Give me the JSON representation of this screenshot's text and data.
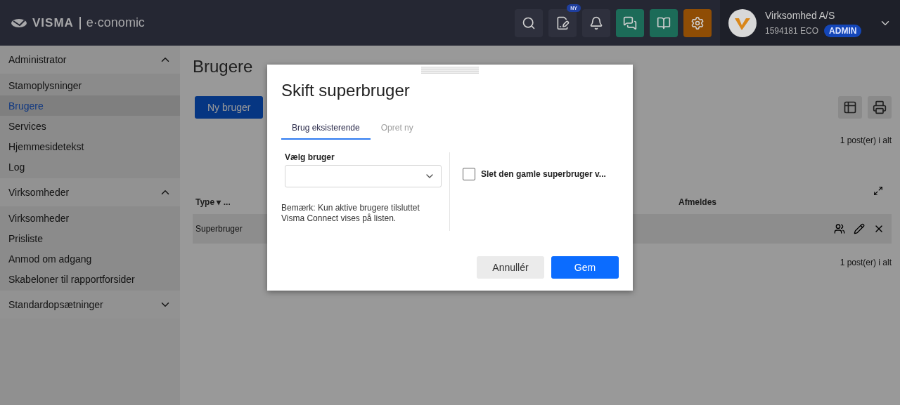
{
  "header": {
    "logo": {
      "brand": "VISMA",
      "product": "e·conomic"
    },
    "tools": [
      {
        "kind": "search",
        "color": "#2e303d"
      },
      {
        "kind": "document",
        "color": "#2e303d",
        "badge": "NY"
      },
      {
        "kind": "bell",
        "color": "#2e303d"
      },
      {
        "kind": "chat",
        "color": "#1c6b58"
      },
      {
        "kind": "book",
        "color": "#1c6b58"
      },
      {
        "kind": "gear",
        "color": "#8f4d05"
      }
    ],
    "account": {
      "company": "Virksomhed A/S",
      "number": "1594181 ECO",
      "role": "ADMIN"
    }
  },
  "sidebar": {
    "groups": [
      {
        "title": "Administrator",
        "expanded": true,
        "items": [
          {
            "label": "Stamoplysninger",
            "selected": false
          },
          {
            "label": "Brugere",
            "selected": true
          },
          {
            "label": "Services",
            "selected": false
          },
          {
            "label": "Hjemmesidetekst",
            "selected": false
          },
          {
            "label": "Log",
            "selected": false
          }
        ]
      },
      {
        "title": "Virksomheder",
        "expanded": true,
        "items": [
          {
            "label": "Virksomheder",
            "selected": false
          },
          {
            "label": "Prisliste",
            "selected": false
          },
          {
            "label": "Anmod om adgang",
            "selected": false
          },
          {
            "label": "Skabeloner til rapportforsider",
            "selected": false
          }
        ]
      },
      {
        "title": "Standardopsætninger",
        "expanded": false
      }
    ]
  },
  "page": {
    "title": "Brugere",
    "new_button": "Ny bruger",
    "count_top": "1 post(er) i alt",
    "columns": [
      {
        "label": "Type ▾ ..."
      },
      {
        "label": "Afmeldes"
      }
    ],
    "rows": [
      {
        "type": "Superbruger"
      }
    ],
    "count_bottom": "1 post(er) i alt"
  },
  "dialog": {
    "title": "Skift superbruger",
    "tabs": [
      {
        "label": "Brug eksisterende",
        "selected": true
      },
      {
        "label": "Opret ny",
        "selected": false
      }
    ],
    "field_label": "Vælg bruger",
    "note": "Bemærk: Kun aktive brugere tilsluttet Visma Connect vises på listen.",
    "checkbox": {
      "label": "Slet den gamle superbruger v...",
      "checked": false
    },
    "buttons": [
      {
        "label": "Annullér",
        "kind": "secondary"
      },
      {
        "label": "Gem",
        "kind": "primary"
      }
    ]
  }
}
